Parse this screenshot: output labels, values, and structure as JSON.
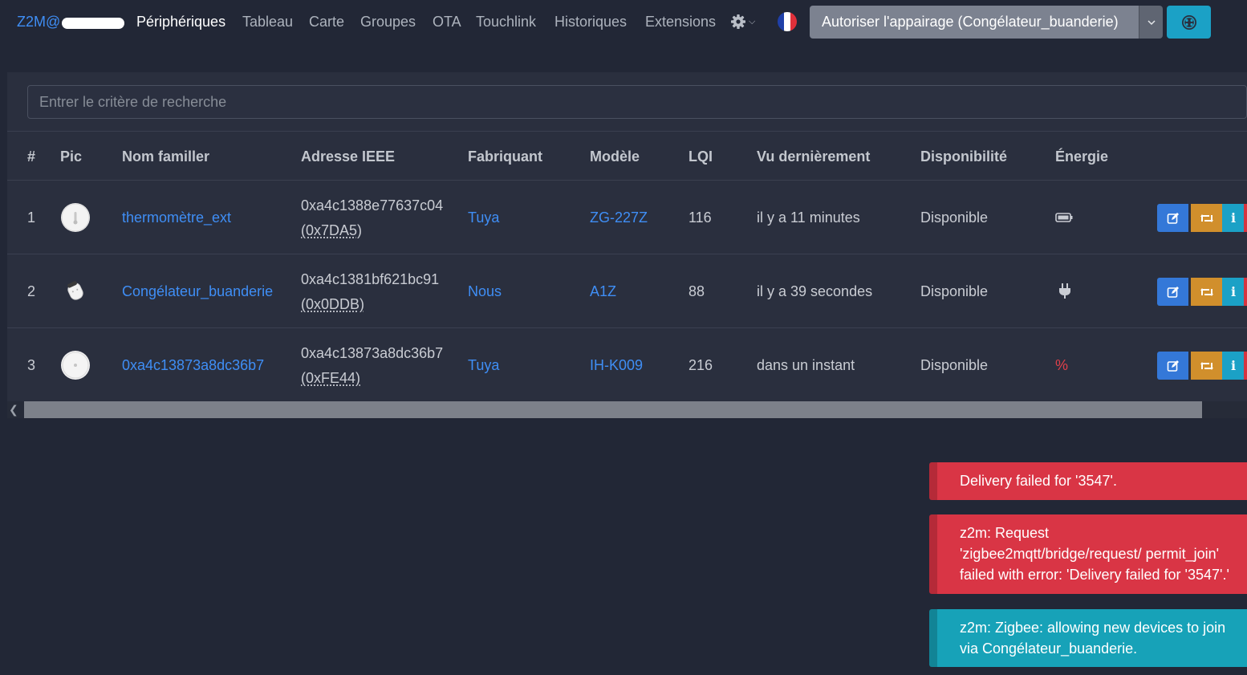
{
  "navbar": {
    "brand": "Z2M@",
    "items": [
      "Périphériques",
      "Tableau",
      "Carte",
      "Groupes",
      "OTA",
      "Touchlink",
      "Historiques",
      "Extensions"
    ],
    "active_item": "Périphériques",
    "settings_icon": "gear-icon",
    "language_flag": "flag-fr-icon",
    "pair_button_label": "Autoriser l'appairage (Congélateur_buanderie)",
    "dashboard_icon": "dashboard-icon"
  },
  "search": {
    "placeholder": "Entrer le critère de recherche",
    "value": ""
  },
  "table": {
    "headers": [
      "#",
      "Pic",
      "Nom familler",
      "Adresse IEEE",
      "Fabriquant",
      "Modèle",
      "LQI",
      "Vu dernièrement",
      "Disponibilité",
      "Énergie"
    ],
    "rows": [
      {
        "index": "1",
        "name": "thermomètre_ext",
        "ieee": "0xa4c1388e77637c04",
        "short": "(0x7DA5)",
        "manufacturer": "Tuya",
        "model": "ZG-227Z",
        "lqi": "116",
        "last_seen": "il y a 11 minutes",
        "availability": "Disponible",
        "power_icon": "battery-icon",
        "power_text": ""
      },
      {
        "index": "2",
        "name": "Congélateur_buanderie",
        "ieee": "0xa4c1381bf621bc91",
        "short": "(0x0DDB)",
        "manufacturer": "Nous",
        "model": "A1Z",
        "lqi": "88",
        "last_seen": "il y a 39 secondes",
        "availability": "Disponible",
        "power_icon": "plug-icon",
        "power_text": ""
      },
      {
        "index": "3",
        "name": "0xa4c13873a8dc36b7",
        "ieee": "0xa4c13873a8dc36b7",
        "short": "(0xFE44)",
        "manufacturer": "Tuya",
        "model": "IH-K009",
        "lqi": "216",
        "last_seen": "dans un instant",
        "availability": "Disponible",
        "power_icon": "",
        "power_text": "%"
      }
    ]
  },
  "toasts": [
    {
      "type": "error",
      "text": "Delivery failed for '3547'."
    },
    {
      "type": "error",
      "text": "z2m: Request 'zigbee2mqtt/bridge/request/ permit_join' failed with error: 'Delivery failed for '3547'.'"
    },
    {
      "type": "info",
      "text": "z2m: Zigbee: allowing new devices to join via Congélateur_buanderie."
    }
  ],
  "colors": {
    "background": "#222736",
    "card": "#2a2f3e",
    "link": "#3f8ef5",
    "edit": "#3478d8",
    "rename": "#d18f2c",
    "info": "#1ba1c6",
    "error": "#d93545",
    "toast_info": "#17a2b8"
  }
}
